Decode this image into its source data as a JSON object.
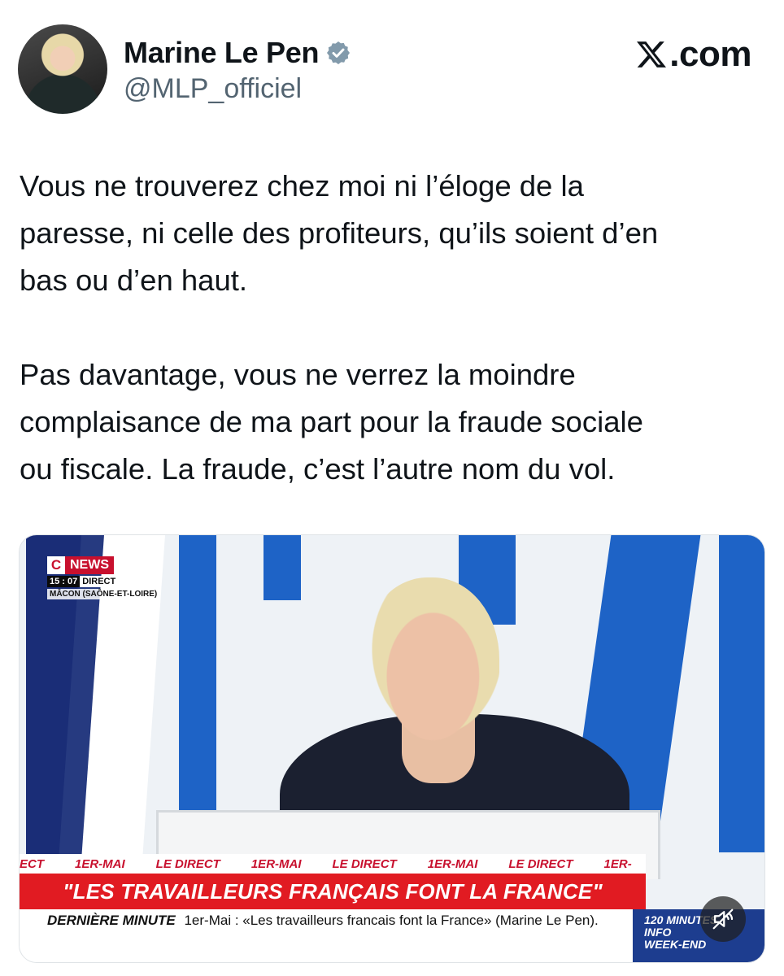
{
  "header": {
    "display_name": "Marine Le Pen",
    "handle": "@MLP_officiel",
    "site_label": ".com",
    "icons": [
      "avatar",
      "verified-badge-icon",
      "x-logo-icon"
    ]
  },
  "tweet": {
    "paragraph_1": {
      "line_1": "Vous ne trouverez chez moi ni l’éloge de la",
      "line_2": "paresse, ni celle des profiteurs, qu’ils soient d’en",
      "line_3": "bas ou d’en haut."
    },
    "paragraph_2": {
      "line_1": "Pas davantage, vous ne verrez la moindre",
      "line_2": "complaisance de ma part pour la fraude sociale",
      "line_3": "ou fiscale. La fraude, c’est l’autre nom du vol."
    }
  },
  "media": {
    "channel_logo_c": "C",
    "channel_logo_news": "NEWS",
    "live_time": "15 : 07",
    "live_label": "DIRECT",
    "location": "MÂCON (SAÔNE-ET-LOIRE)",
    "ticker_items": [
      "ECT",
      "1ER-MAI",
      "LE DIRECT",
      "1ER-MAI",
      "LE DIRECT",
      "1ER-MAI",
      "LE DIRECT",
      "1ER-"
    ],
    "headline": "\"LES TRAVAILLEURS FRANÇAIS FONT LA FRANCE\"",
    "breaking_label": "DERNIÈRE MINUTE",
    "breaking_text": "1er-Mai : «Les travailleurs francais font la France» (Marine Le Pen).",
    "promo_line_1": "120 MINUTES",
    "promo_line_2": "INFO",
    "promo_line_3": "WEEK-END",
    "mute_icon": "speaker-muted-icon"
  },
  "colors": {
    "text": "#0f1419",
    "handle": "#536471",
    "verified": "#829aab",
    "cnews_red": "#c8102e",
    "headline_red": "#e11b22",
    "promo_blue": "#1d3d8f",
    "stage_blue": "#1e63c6"
  }
}
